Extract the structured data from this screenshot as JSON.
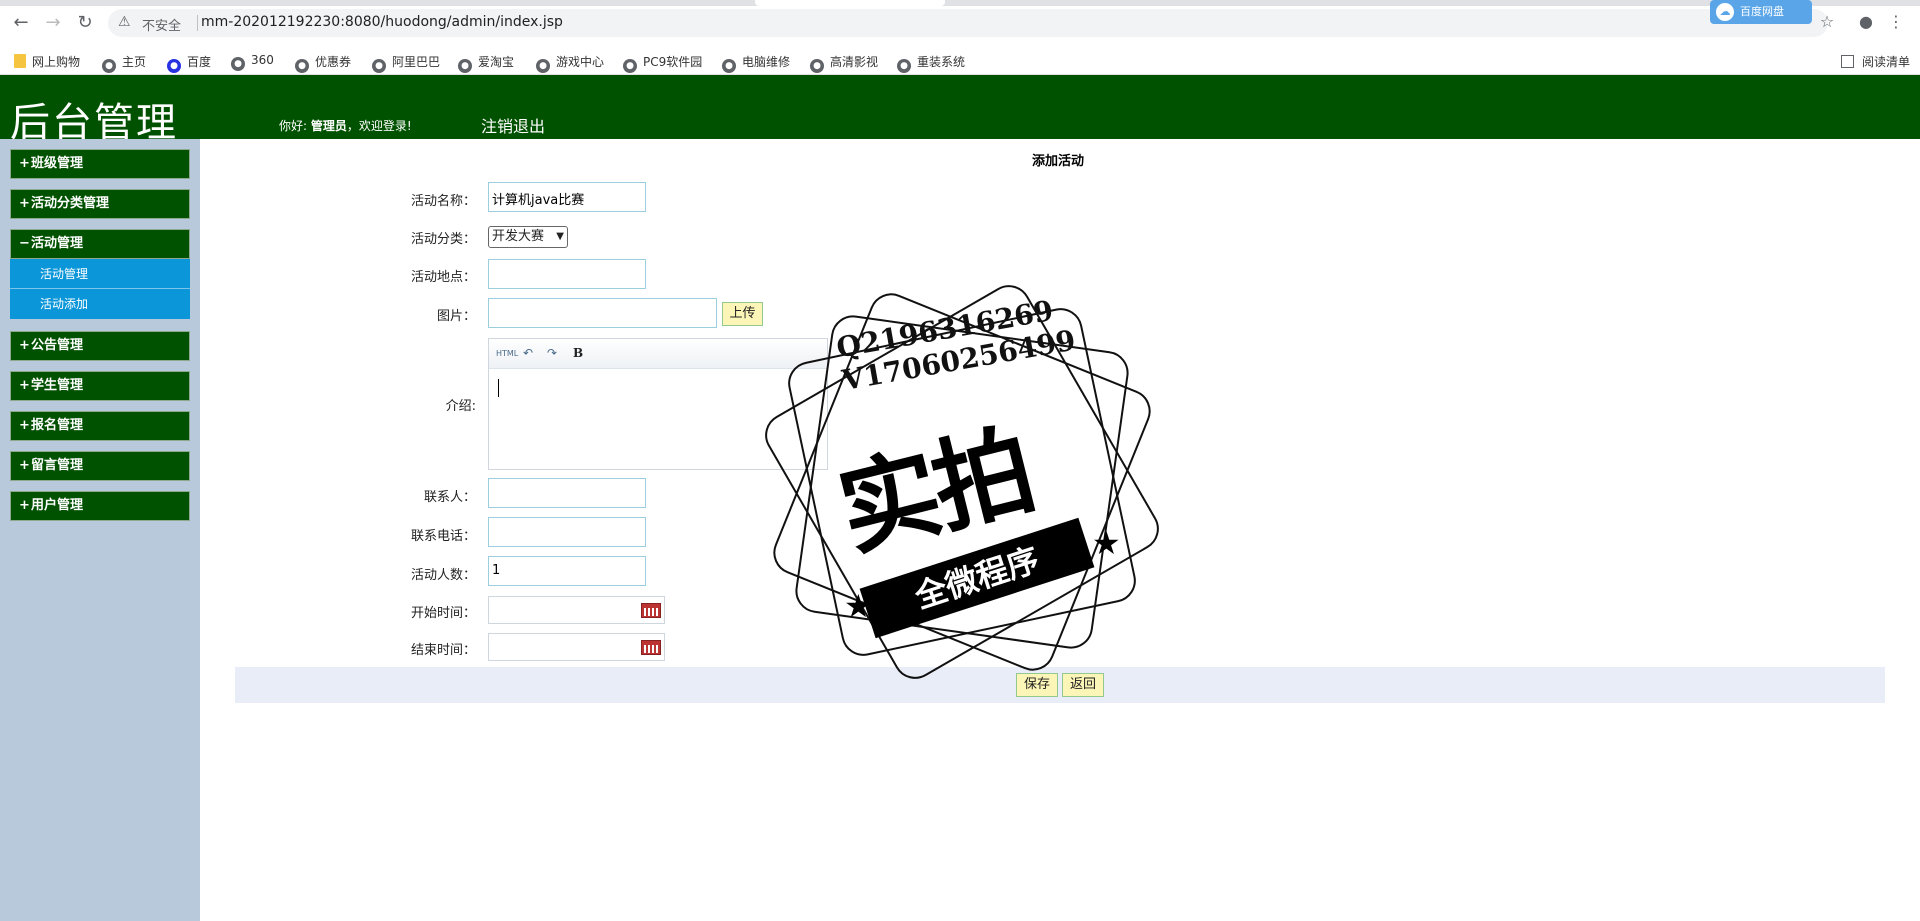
{
  "browser": {
    "nav": {
      "back": "←",
      "forward": "→",
      "reload": "↻"
    },
    "security_label": "不安全",
    "url": "mm-202012192230:8080/huodong/admin/index.jsp",
    "extension_label": "百度网盘",
    "bookmarks": [
      "网上购物",
      "主页",
      "百度",
      "360",
      "优惠券",
      "阿里巴巴",
      "爱淘宝",
      "游戏中心",
      "PC9软件园",
      "电脑维修",
      "高清影视",
      "重装系统"
    ],
    "reading_list": "阅读清单"
  },
  "header": {
    "title": "后台管理",
    "greeting_prefix": "你好:",
    "user": "管理员",
    "greeting_suffix": "，欢迎登录!",
    "logout": "注销退出"
  },
  "sidebar": {
    "items": [
      {
        "label": "班级管理",
        "sign": "+"
      },
      {
        "label": "活动分类管理",
        "sign": "+"
      },
      {
        "label": "活动管理",
        "sign": "−"
      },
      {
        "label": "公告管理",
        "sign": "+"
      },
      {
        "label": "学生管理",
        "sign": "+"
      },
      {
        "label": "报名管理",
        "sign": "+"
      },
      {
        "label": "留言管理",
        "sign": "+"
      },
      {
        "label": "用户管理",
        "sign": "+"
      }
    ],
    "subitems": [
      "活动管理",
      "活动添加"
    ]
  },
  "form": {
    "title": "添加活动",
    "fields": {
      "name": {
        "label": "活动名称：",
        "value": "计算机java比赛"
      },
      "category": {
        "label": "活动分类：",
        "value": "开发大赛"
      },
      "location": {
        "label": "活动地点：",
        "value": ""
      },
      "image": {
        "label": "图片：",
        "value": ""
      },
      "intro": {
        "label": "介绍:"
      },
      "contact": {
        "label": "联系人：",
        "value": ""
      },
      "phone": {
        "label": "联系电话：",
        "value": ""
      },
      "count": {
        "label": "活动人数：",
        "value": "1"
      },
      "start": {
        "label": "开始时间：",
        "value": ""
      },
      "end": {
        "label": "结束时间：",
        "value": ""
      }
    },
    "upload_button": "上传",
    "editor_toolbar": {
      "html": "HTML",
      "undo": "↶",
      "redo": "↷",
      "bold": "B"
    },
    "save_button": "保存",
    "back_button": "返回"
  },
  "watermark": {
    "line1": "Q2196316269",
    "line2": "V17060256499",
    "main": "实拍",
    "ribbon": "全微程序"
  }
}
